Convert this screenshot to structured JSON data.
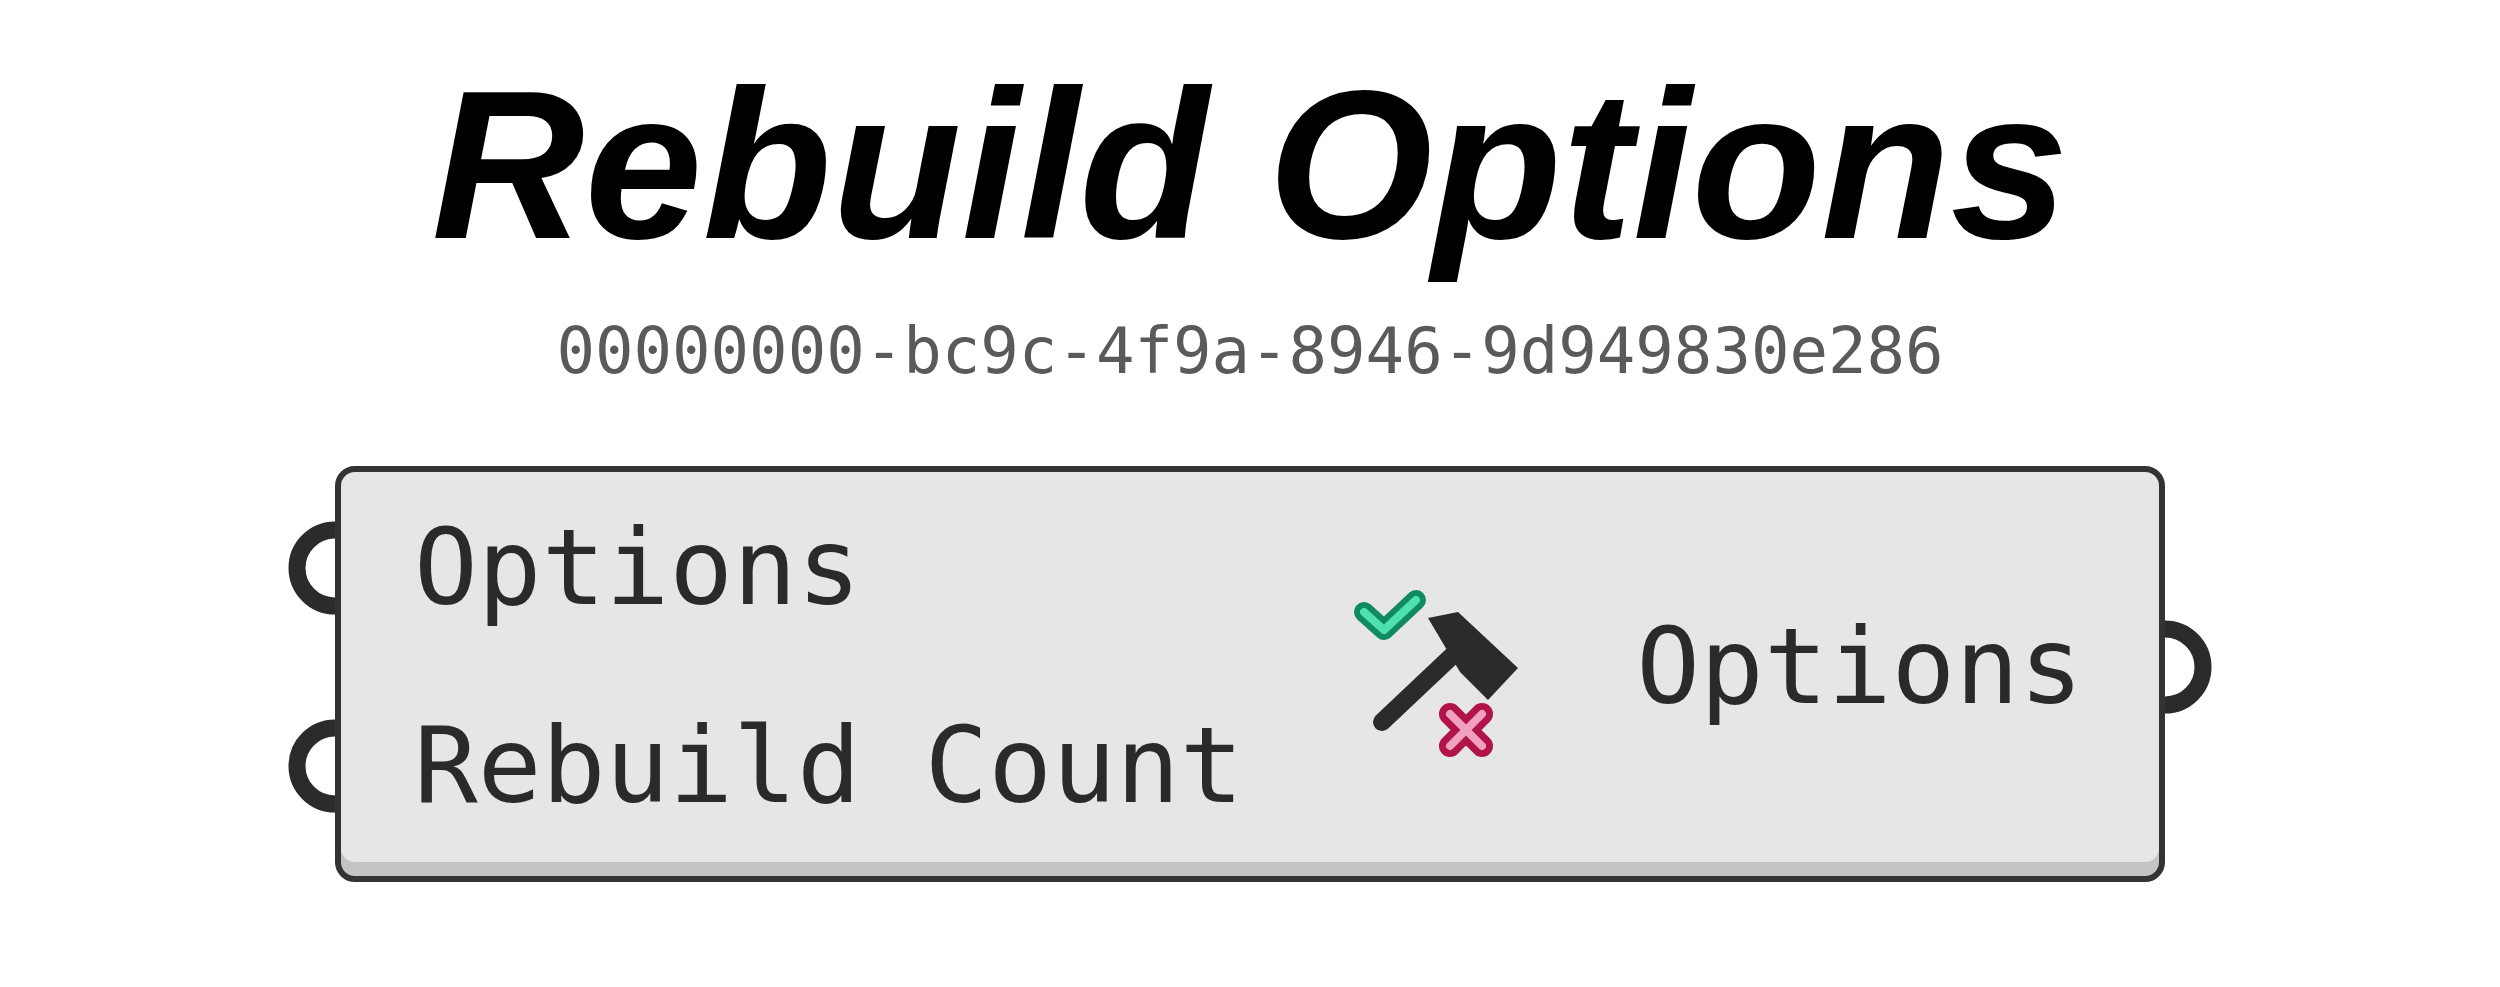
{
  "title": "Rebuild Options",
  "guid": "00000000-bc9c-4f9a-8946-9d949830e286",
  "component": {
    "inputs": [
      {
        "label": "Options"
      },
      {
        "label": "Rebuild Count"
      }
    ],
    "outputs": [
      {
        "label": "Options"
      }
    ]
  }
}
